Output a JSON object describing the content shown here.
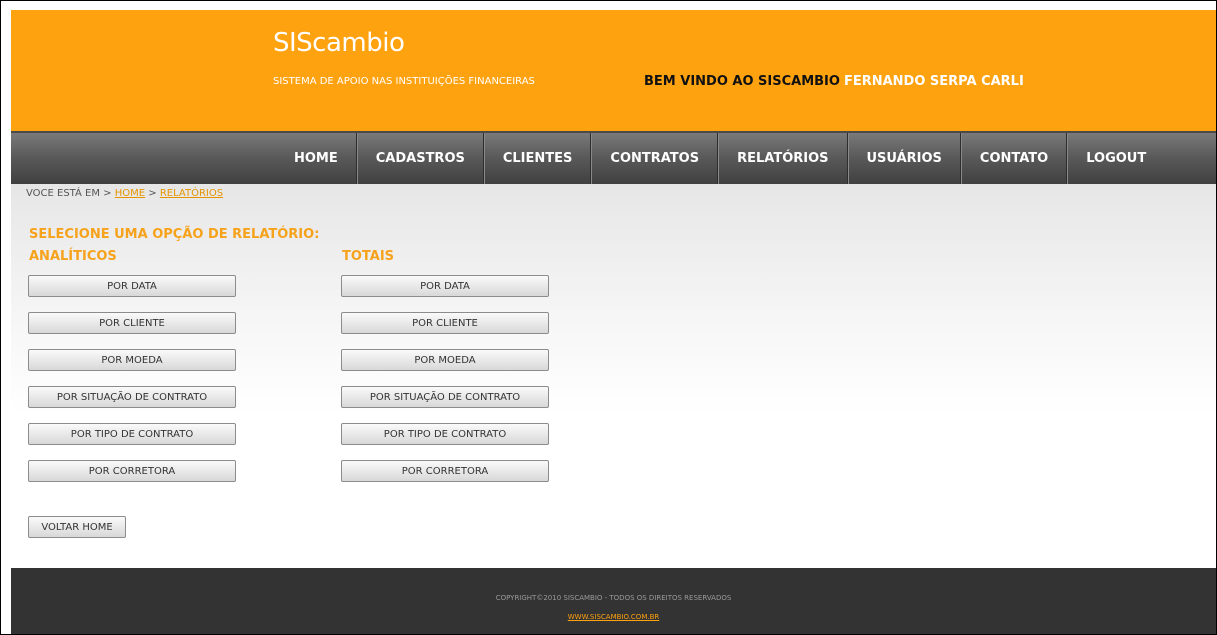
{
  "header": {
    "logo": "SIScambio",
    "tagline": "SISTEMA DE APOIO NAS INSTITUIÇÕES FINANCEIRAS",
    "welcome_text": "BEM VINDO AO SISCAMBIO",
    "user_name": "FERNANDO SERPA CARLI"
  },
  "nav": {
    "items": [
      "HOME",
      "CADASTROS",
      "CLIENTES",
      "CONTRATOS",
      "RELATÓRIOS",
      "USUÁRIOS",
      "CONTATO",
      "LOGOUT"
    ]
  },
  "breadcrumb": {
    "prefix": "VOCE ESTÁ EM >",
    "separator": ">",
    "home": "HOME",
    "current": "RELATÓRIOS"
  },
  "main": {
    "title": "SELECIONE UMA OPÇÃO DE RELATÓRIO:",
    "analiticos": {
      "title": "ANALÍTICOS",
      "buttons": [
        "POR DATA",
        "POR CLIENTE",
        "POR MOEDA",
        "POR SITUAÇÃO DE CONTRATO",
        "POR TIPO DE CONTRATO",
        "POR CORRETORA"
      ]
    },
    "totais": {
      "title": "TOTAIS",
      "buttons": [
        "POR DATA",
        "POR CLIENTE",
        "POR MOEDA",
        "POR SITUAÇÃO DE CONTRATO",
        "POR TIPO DE CONTRATO",
        "POR CORRETORA"
      ]
    },
    "back_label": "VOLTAR HOME"
  },
  "footer": {
    "copyright": "COPYRIGHT©2010 SISCAMBIO - TODOS OS DIREITOS RESERVADOS",
    "site": "WWW.SISCAMBIO.COM.BR"
  },
  "colors": {
    "brand_orange": "#ffa20f",
    "nav_gray": "#4a4a4a",
    "footer_dark": "#333333"
  }
}
